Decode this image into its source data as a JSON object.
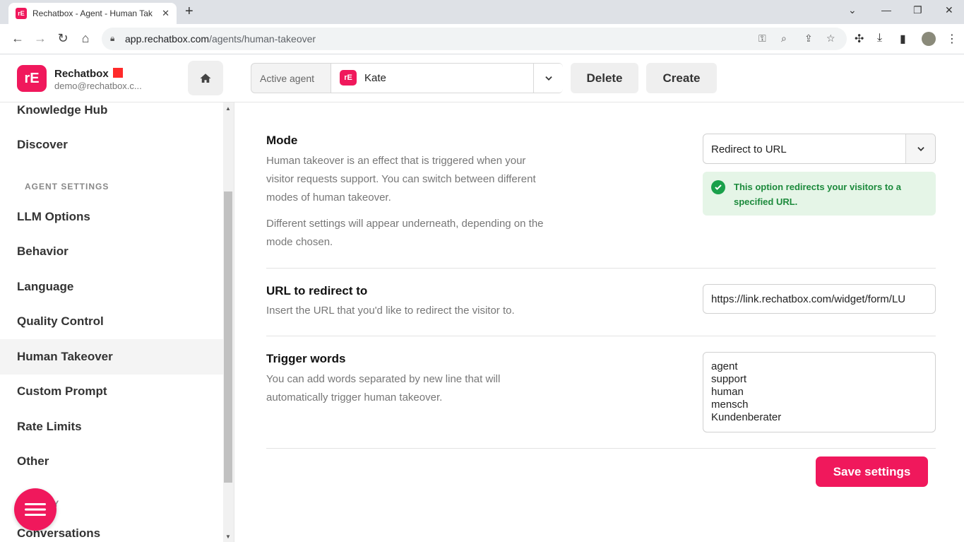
{
  "browser": {
    "tab_title": "Rechatbox - Agent - Human Tak",
    "url_host": "app.rechatbox.com",
    "url_path": "/agents/human-takeover"
  },
  "header": {
    "brand": "Rechatbox",
    "email": "demo@rechatbox.c...",
    "active_agent_label": "Active agent",
    "active_agent_name": "Kate",
    "delete_label": "Delete",
    "create_label": "Create"
  },
  "sidebar": {
    "items_top": [
      "Knowledge Hub",
      "Discover"
    ],
    "section_agent": "AGENT SETTINGS",
    "agent_items": [
      "LLM Options",
      "Behavior",
      "Language",
      "Quality Control",
      "Human Takeover",
      "Custom Prompt",
      "Rate Limits",
      "Other"
    ],
    "active_item": "Human Takeover",
    "section_history_partial": "RY",
    "bottom_item": "Conversations"
  },
  "mode": {
    "title": "Mode",
    "desc1": "Human takeover is an effect that is triggered when your visitor requests support. You can switch between different modes of human takeover.",
    "desc2": "Different settings will appear underneath, depending on the mode chosen.",
    "selected": "Redirect to URL",
    "alert": "This option redirects your visitors to a specified URL."
  },
  "url_section": {
    "title": "URL to redirect to",
    "desc": "Insert the URL that you'd like to redirect the visitor to.",
    "value": "https://link.rechatbox.com/widget/form/LU"
  },
  "trigger_section": {
    "title": "Trigger words",
    "desc": "You can add words separated by new line that will automatically trigger human takeover.",
    "words": [
      "agent",
      "support",
      "human",
      "mensch",
      "Kundenberater"
    ]
  },
  "save_label": "Save settings",
  "colors": {
    "brand": "#f0185c",
    "success": "#1aa04b",
    "success_bg": "#e5f5e7"
  }
}
